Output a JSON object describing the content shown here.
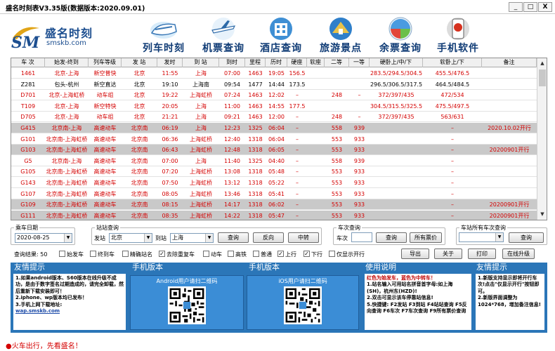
{
  "window": {
    "title": "盛名时刻表V3.35版(数据版本:2020.09.01)",
    "min_label": "_",
    "max_label": "□",
    "close_label": "X"
  },
  "header": {
    "brand_cn": "盛名时刻",
    "brand_url": "smskb.com",
    "nav": [
      {
        "label": "列车时刻",
        "icon": "train-icon"
      },
      {
        "label": "机票查询",
        "icon": "airplane-icon"
      },
      {
        "label": "酒店查询",
        "icon": "hotel-icon"
      },
      {
        "label": "旅游景点",
        "icon": "tourism-icon"
      },
      {
        "label": "余票查询",
        "icon": "ticket-icon"
      },
      {
        "label": "手机软件",
        "icon": "phone-icon"
      }
    ]
  },
  "table": {
    "columns": [
      "车 次",
      "始发-终到",
      "列车等级",
      "发 站",
      "发时",
      "到 站",
      "到时",
      "里程",
      "历时",
      "硬座",
      "软座",
      "二等",
      "一等",
      "硬卧上/中/下",
      "软卧上/下",
      "备注"
    ],
    "rows": [
      {
        "c": [
          "1461",
          "北京-上海",
          "新空普快",
          "北京",
          "11:55",
          "上海",
          "07:00",
          "1463",
          "19:05",
          "156.5",
          "",
          "",
          "",
          "283.5/294.5/304.5",
          "455.5/476.5",
          ""
        ],
        "sel": false
      },
      {
        "c": [
          "Z281",
          "包头-杭州",
          "新空直达",
          "北京",
          "19:10",
          "上海南",
          "09:54",
          "1477",
          "14:44",
          "173.5",
          "",
          "",
          "",
          "296.5/306.5/317.5",
          "464.5/484.5",
          ""
        ],
        "sel": false
      },
      {
        "c": [
          "D701",
          "北京-上海虹桥",
          "动车组",
          "北京",
          "19:22",
          "上海虹桥",
          "07:24",
          "1463",
          "12:02",
          "–",
          "",
          "248",
          "–",
          "372/397/435",
          "472/534",
          ""
        ],
        "sel": false
      },
      {
        "c": [
          "T109",
          "北京-上海",
          "新空特快",
          "北京",
          "20:05",
          "上海",
          "11:00",
          "1463",
          "14:55",
          "177.5",
          "",
          "",
          "",
          "304.5/315.5/325.5",
          "475.5/497.5",
          ""
        ],
        "sel": false
      },
      {
        "c": [
          "D705",
          "北京-上海",
          "动车组",
          "北京",
          "21:21",
          "上海",
          "09:21",
          "1463",
          "12:00",
          "–",
          "",
          "248",
          "–",
          "372/397/435",
          "563/631",
          ""
        ],
        "sel": false
      },
      {
        "c": [
          "G415",
          "北京南-上海",
          "高速动车",
          "北京南",
          "06:19",
          "上海",
          "12:23",
          "1325",
          "06:04",
          "–",
          "",
          "558",
          "939",
          "",
          "–",
          "2020.10.02开行"
        ],
        "sel": true
      },
      {
        "c": [
          "G101",
          "北京南-上海虹桥",
          "高速动车",
          "北京南",
          "06:36",
          "上海虹桥",
          "12:40",
          "1318",
          "06:04",
          "–",
          "",
          "553",
          "933",
          "",
          "–",
          ""
        ],
        "sel": false
      },
      {
        "c": [
          "G103",
          "北京南-上海虹桥",
          "高速动车",
          "北京南",
          "06:43",
          "上海虹桥",
          "12:48",
          "1318",
          "06:05",
          "–",
          "",
          "553",
          "933",
          "",
          "–",
          "20200901开行"
        ],
        "sel": true
      },
      {
        "c": [
          "G5",
          "北京南-上海",
          "高速动车",
          "北京南",
          "07:00",
          "上海",
          "11:40",
          "1325",
          "04:40",
          "–",
          "",
          "558",
          "939",
          "",
          "–",
          ""
        ],
        "sel": false
      },
      {
        "c": [
          "G105",
          "北京南-上海虹桥",
          "高速动车",
          "北京南",
          "07:20",
          "上海虹桥",
          "13:08",
          "1318",
          "05:48",
          "–",
          "",
          "553",
          "933",
          "",
          "–",
          ""
        ],
        "sel": false
      },
      {
        "c": [
          "G143",
          "北京南-上海虹桥",
          "高速动车",
          "北京南",
          "07:50",
          "上海虹桥",
          "13:12",
          "1318",
          "05:22",
          "–",
          "",
          "553",
          "933",
          "",
          "–",
          ""
        ],
        "sel": false
      },
      {
        "c": [
          "G107",
          "北京南-上海虹桥",
          "高速动车",
          "北京南",
          "08:05",
          "上海虹桥",
          "13:46",
          "1318",
          "05:41",
          "–",
          "",
          "553",
          "933",
          "",
          "–",
          ""
        ],
        "sel": false
      },
      {
        "c": [
          "G109",
          "北京南-上海虹桥",
          "高速动车",
          "北京南",
          "08:15",
          "上海虹桥",
          "14:17",
          "1318",
          "06:02",
          "–",
          "",
          "553",
          "933",
          "",
          "–",
          "20200901开行"
        ],
        "sel": true
      },
      {
        "c": [
          "G111",
          "北京南-上海虹桥",
          "高速动车",
          "北京南",
          "08:35",
          "上海虹桥",
          "14:22",
          "1318",
          "05:47",
          "–",
          "",
          "553",
          "933",
          "",
          "–",
          "20200901开行"
        ],
        "sel": true
      }
    ]
  },
  "controls": {
    "date_legend": "乘车日期",
    "date_value": "2020-08-25",
    "station_legend": "站站查询",
    "from_label": "发站",
    "from_value": "北京",
    "to_label": "到站",
    "to_value": "上海",
    "query_btn": "查询",
    "reverse_btn": "反向",
    "transfer_btn": "中转",
    "train_legend": "车次查询",
    "train_label": "车次",
    "train_value": "",
    "train_query_btn": "查询",
    "all_prices_btn": "所有票价",
    "station_all_legend": "车站所有车次查询",
    "station_all_value": "",
    "station_all_query_btn": "查询",
    "result_label": "查询结果: 50",
    "checkboxes": [
      {
        "label": "始发车",
        "checked": false
      },
      {
        "label": "终到车",
        "checked": false
      },
      {
        "label": "精确站名",
        "checked": false
      },
      {
        "label": "去除重复车",
        "checked": true
      },
      {
        "label": "动车",
        "checked": false
      },
      {
        "label": "高铁",
        "checked": false
      },
      {
        "label": "普通",
        "checked": false
      },
      {
        "label": "上行",
        "checked": true
      },
      {
        "label": "下行",
        "checked": true
      },
      {
        "label": "仅显示开行",
        "checked": false
      }
    ],
    "check_mark": "✓",
    "export_btn": "导出",
    "about_btn": "关于",
    "print_btn": "打印",
    "upgrade_btn": "在线升级"
  },
  "panels": {
    "tips1_title": "友情提示",
    "tips1_lines": [
      "1.如果android版本、S60版本在线升级不成功，是由于数字签名过期造成的，请完全卸载，然后重新下载安装即可！",
      "2.iphone、wp版本均已发布！",
      "3.手机上网下载地址:",
      "wap.smskb.com"
    ],
    "android_title": "手机版本",
    "android_caption": "Android用户请扫二维码",
    "ios_title": "手机版本",
    "ios_caption": "iOS用户请扫二维码",
    "usage_title": "使用说明",
    "usage_lines": [
      "红色为始发车，蓝色为中转车！",
      "1.站名输入可用站名拼音首字母:如上海(SH)，杭州东(HZD)!",
      "2.双击可显示该车停靠站信息!",
      "5.快捷键: F2发站 F3到站 F4站站查询 F5反向查询 F6车次 F7车次查询 F9所有票价查询"
    ],
    "tips2_title": "友情提示",
    "tips2_lines": [
      "1.新版支持显示即将开行车次!点击\"仅显示开行\"按钮即可。",
      "2.新版界面调整为1024*768，增加备注信息!"
    ]
  },
  "footer": {
    "text": "●火车出行，先看盛名！"
  }
}
